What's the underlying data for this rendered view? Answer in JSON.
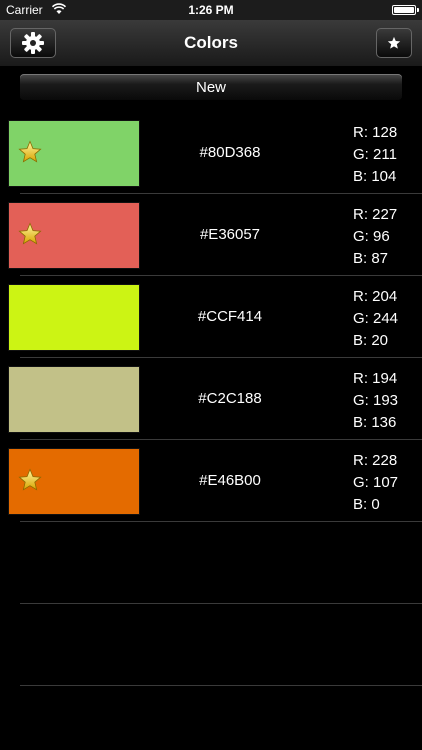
{
  "status_bar": {
    "carrier": "Carrier",
    "time": "1:26 PM"
  },
  "nav": {
    "title": "Colors",
    "left_icon": "gear-icon",
    "right_icon": "star-icon"
  },
  "new_button": {
    "label": "New"
  },
  "colors": [
    {
      "hex": "#80D368",
      "r": "R: 128",
      "g": "G: 211",
      "b": "B: 104",
      "swatch": "#80D368",
      "favorite": true
    },
    {
      "hex": "#E36057",
      "r": "R: 227",
      "g": "G: 96",
      "b": "B: 87",
      "swatch": "#E36057",
      "favorite": true
    },
    {
      "hex": "#CCF414",
      "r": "R: 204",
      "g": "G: 244",
      "b": "B: 20",
      "swatch": "#CCF414",
      "favorite": false
    },
    {
      "hex": "#C2C188",
      "r": "R: 194",
      "g": "G: 193",
      "b": "B: 136",
      "swatch": "#C2C188",
      "favorite": false
    },
    {
      "hex": "#E46B00",
      "r": "R: 228",
      "g": "G: 107",
      "b": "B: 0",
      "swatch": "#E46B00",
      "favorite": true
    }
  ]
}
